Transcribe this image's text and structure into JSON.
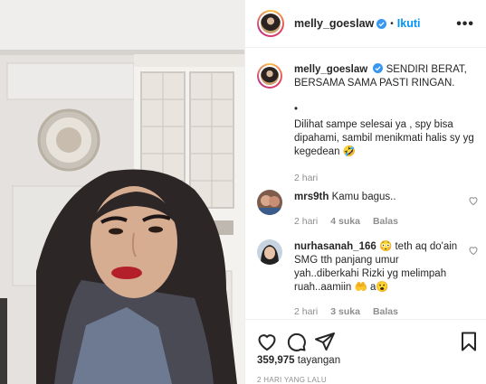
{
  "post": {
    "username": "melly_goeslaw",
    "follow_label": "Ikuti",
    "more_label": "•••"
  },
  "caption": {
    "username": "melly_goeslaw",
    "text_line1": "SENDIRI BERAT, BERSAMA SAMA PASTI RINGAN.",
    "bullet": "•",
    "text_line2": "Dilihat sampe selesai ya , spy bisa dipahami, sambil menikmati halis sy yg kegedean 🤣",
    "time": "2 hari"
  },
  "comments": [
    {
      "username": "mrs9th",
      "text": "Kamu bagus..",
      "time": "2 hari",
      "likes": "4 suka",
      "reply": "Balas"
    },
    {
      "username": "nurhasanah_166",
      "text": "😳 teth aq do'ain SMG tth panjang umur yah..diberkahi Rizki yg melimpah ruah..aamiin 🤲 a😮",
      "time": "2 hari",
      "likes": "3 suka",
      "reply": "Balas"
    }
  ],
  "footer": {
    "views_count": "359,975",
    "views_label": "tayangan",
    "time_ago": "2 HARI YANG LALU"
  },
  "icons": {
    "like": "heart-icon",
    "comment": "comment-icon",
    "share": "paper-plane-icon",
    "save": "bookmark-icon",
    "verified": "verified-badge-icon"
  },
  "colors": {
    "follow_blue": "#0095f6",
    "verified_blue": "#3897f0",
    "muted_text": "#8e8e8e"
  }
}
